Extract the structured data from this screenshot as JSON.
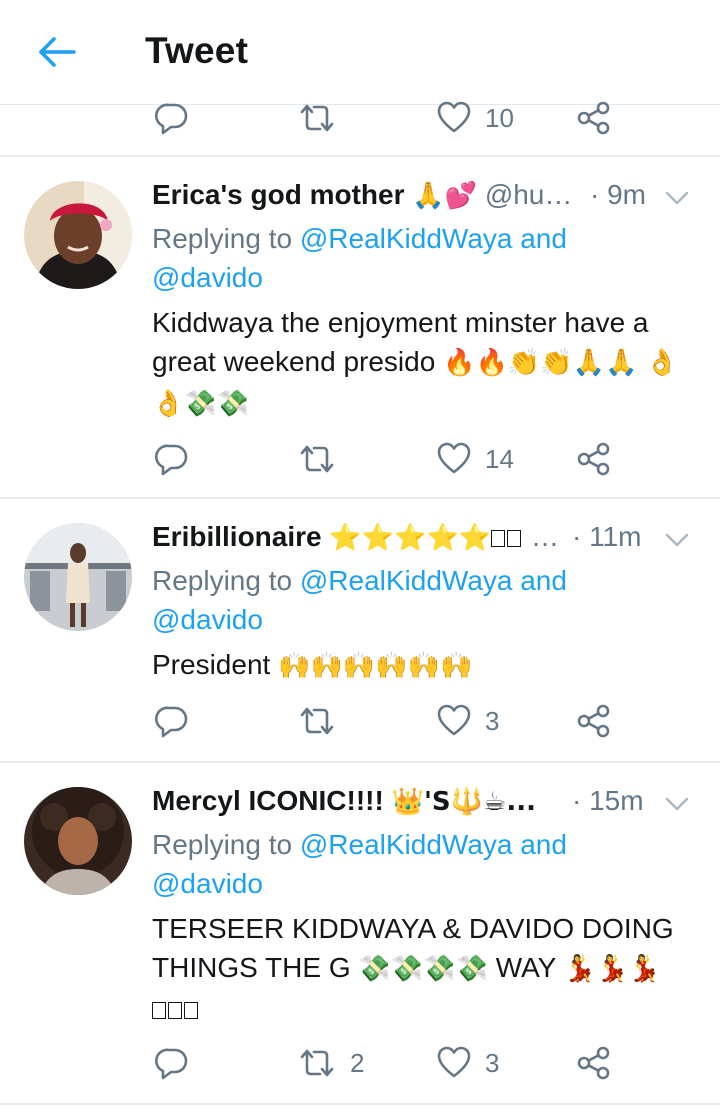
{
  "header": {
    "title": "Tweet",
    "back_icon": "arrow-left-icon",
    "accent": "#1da1f2"
  },
  "top_action_bar": {
    "like_count": "10"
  },
  "tweets": [
    {
      "name": "Erica's god mother",
      "name_emoji": "🙏💕",
      "handle": "@hu…",
      "time": "· 9m",
      "replying_prefix": "Replying to",
      "replying_users": "@RealKiddWaya and",
      "replying_users_2": "@davido",
      "text": "Kiddwaya the enjoyment minster have a great weekend presido",
      "text_emoji": "🔥🔥👏👏🙏🙏 👌👌💸💸",
      "reply_count": "",
      "retweet_count": "",
      "like_count": "14"
    },
    {
      "name": "Eribillionaire",
      "name_emoji": "⭐⭐⭐⭐⭐",
      "handle": "…",
      "time": "· 11m",
      "replying_prefix": "Replying to",
      "replying_users": "@RealKiddWaya and",
      "replying_users_2": "@davido",
      "text": "President",
      "text_emoji": "🙌🙌🙌🙌🙌🙌",
      "reply_count": "",
      "retweet_count": "",
      "like_count": "3"
    },
    {
      "name": "Mercyl ICONIC!!!!",
      "name_emoji": "👑'S🔱☕...",
      "handle": "",
      "time": "· 15m",
      "replying_prefix": "Replying to",
      "replying_users": "@RealKiddWaya and",
      "replying_users_2": "@davido",
      "text": "TERSEER KIDDWAYA & DAVIDO DOING THINGS THE G",
      "text_emoji": "💸💸💸💸",
      "text_after": "WAY",
      "text_emoji_2": "💃💃💃",
      "reply_count": "",
      "retweet_count": "2",
      "like_count": "3"
    }
  ]
}
